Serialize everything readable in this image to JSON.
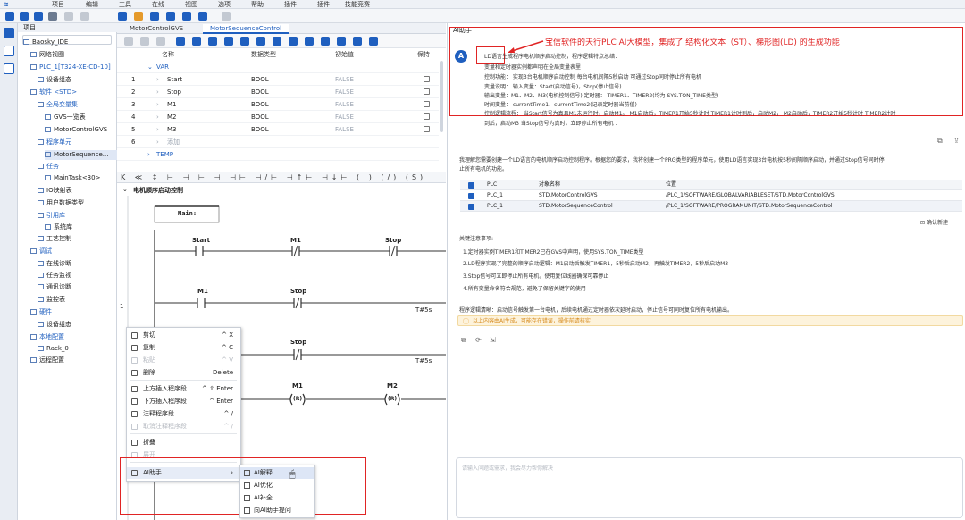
{
  "menubar": {
    "items": [
      "项目",
      "编辑",
      "工具",
      "在线",
      "视图",
      "选项",
      "帮助",
      "插件",
      "插件",
      "技能竞赛"
    ]
  },
  "tree": {
    "header": "项目",
    "items": [
      {
        "label": "Baosky_IDE",
        "indent": 0
      },
      {
        "label": "网络视图",
        "indent": 1
      },
      {
        "label": "PLC_1[T324-XE-CD-10]",
        "indent": 1
      },
      {
        "label": "设备组态",
        "indent": 2
      },
      {
        "label": "软件 <STD>",
        "indent": 1
      },
      {
        "label": "全局变量集",
        "indent": 2
      },
      {
        "label": "GVS一览表",
        "indent": 3
      },
      {
        "label": "MotorControlGVS",
        "indent": 3
      },
      {
        "label": "程序单元",
        "indent": 2
      },
      {
        "label": "MotorSequence...",
        "indent": 3
      },
      {
        "label": "任务",
        "indent": 2
      },
      {
        "label": "MainTask<30>",
        "indent": 3
      },
      {
        "label": "IO映射表",
        "indent": 2
      },
      {
        "label": "用户数据类型",
        "indent": 2
      },
      {
        "label": "引用库",
        "indent": 2
      },
      {
        "label": "系统库",
        "indent": 3
      },
      {
        "label": "工艺控制",
        "indent": 2
      },
      {
        "label": "调试",
        "indent": 1
      },
      {
        "label": "在线诊断",
        "indent": 2
      },
      {
        "label": "任务监视",
        "indent": 2
      },
      {
        "label": "通讯诊断",
        "indent": 2
      },
      {
        "label": "监控表",
        "indent": 2
      },
      {
        "label": "硬件",
        "indent": 1
      },
      {
        "label": "设备组态",
        "indent": 2
      },
      {
        "label": "本地配置",
        "indent": 1
      },
      {
        "label": "Rack_0",
        "indent": 2
      },
      {
        "label": "远程配置",
        "indent": 1
      }
    ]
  },
  "tabs": [
    "MotorControlGVS",
    "MotorSequenceControl"
  ],
  "vartable": {
    "headers": [
      "名称",
      "数据类型",
      "初始值",
      "保持"
    ],
    "sections": [
      "VAR",
      "TEMP"
    ],
    "rows": [
      {
        "num": "1",
        "name": "Start",
        "type": "BOOL",
        "init": "FALSE"
      },
      {
        "num": "2",
        "name": "Stop",
        "type": "BOOL",
        "init": "FALSE"
      },
      {
        "num": "3",
        "name": "M1",
        "type": "BOOL",
        "init": "FALSE"
      },
      {
        "num": "4",
        "name": "M2",
        "type": "BOOL",
        "init": "FALSE"
      },
      {
        "num": "5",
        "name": "M3",
        "type": "BOOL",
        "init": "FALSE"
      },
      {
        "num": "6",
        "name": "添加",
        "type": "",
        "init": ""
      }
    ]
  },
  "ladder": {
    "rung_title": "电机顺序启动控制",
    "label_main": "Main:",
    "rung_number": "1",
    "contacts": {
      "start": "Start",
      "m1a": "M1",
      "stop_a": "Stop",
      "m1b": "M1",
      "stop_b": "Stop",
      "stop_c": "Stop",
      "m1_r": "M1",
      "m2_r": "M2",
      "r_symbol": "(R)",
      "timer_a": "T#5s",
      "timer_b": "T#5s"
    }
  },
  "contextmenu": {
    "items": [
      {
        "label": "剪切",
        "shortcut": "^ X",
        "disabled": false
      },
      {
        "label": "复制",
        "shortcut": "^ C",
        "disabled": false
      },
      {
        "label": "粘贴",
        "shortcut": "^ V",
        "disabled": true
      },
      {
        "label": "删除",
        "shortcut": "Delete",
        "disabled": false
      },
      {
        "label": "上方插入程序段",
        "shortcut": "^ ⇧ Enter",
        "disabled": false
      },
      {
        "label": "下方插入程序段",
        "shortcut": "^ Enter",
        "disabled": false
      },
      {
        "label": "注释程序段",
        "shortcut": "^ /",
        "disabled": false
      },
      {
        "label": "取消注释程序段",
        "shortcut": "^ /",
        "disabled": true
      },
      {
        "label": "折叠",
        "shortcut": "",
        "disabled": false
      },
      {
        "label": "展开",
        "shortcut": "",
        "disabled": true
      },
      {
        "label": "AI助手",
        "shortcut": "›",
        "disabled": false
      }
    ],
    "submenu": [
      "AI解释",
      "AI优化",
      "AI补全",
      "向AI助手提问"
    ]
  },
  "ai": {
    "panel_title": "AI助手",
    "annotation": "宝信软件的天行PLC AI大模型，集成了 结构化文本（ST）、梯形图(LD) 的生成功能",
    "avatar_letter": "A",
    "summary_lines": [
      "LD语言生成程序电机顺序启动控制，程序逻辑特点总结：",
      "变量和定时器实例都声明在全局变量表里",
      "控制功能： 实现3台电机顺序启动控制 每台电机间隔5秒启动 可通过Stop同时停止所有电机",
      "变量说明： 输入变量：Start(启动信号)，Stop(停止信号)",
      "输出变量：M1、M2、M3(电机控制信号) 定时器： TIMER1、TIMER2(均为 SYS.TON_TIME类型)",
      "时间变量： currentTime1、currentTime2(记录定时器当前值)",
      "控制逻辑流程： 当Start信号为真且M1未运行时，启动M1。 M1启动后，TIMER1开始5秒计时 TIMER1计时到后，启动M2， M2启动后，TIMER2开始5秒计时 TIMER2计时",
      "到后，启动M3 当Stop信号为真时，立即停止所有电机 ."
    ],
    "intro": [
      "我理解您需要创建一个LD语言的电机顺序启动控制程序。根据您的要求，我将创建一个PRG类型的程序单元，使用LD语言实现3台电机按5秒间隔顺序启动，并通过Stop信号同时停",
      "止所有电机的功能。"
    ],
    "table": {
      "headers": [
        "PLC",
        "对象名称",
        "位置"
      ],
      "rows": [
        [
          "PLC_1",
          "STD.MotorControlGVS",
          "/PLC_1/SOFTWARE/GLOBALVARIABLESET/STD.MotorControlGVS"
        ],
        [
          "PLC_1",
          "STD.MotorSequenceControl",
          "/PLC_1/SOFTWARE/PROGRAMUNIT/STD.MotorSequenceControl"
        ]
      ]
    },
    "confirm_button": "确认新建",
    "notes_title": "关键注意事项:",
    "notes": [
      "1.定时器实例TIMER1和TIMER2已在GVS中声明，使用SYS.TON_TIME类型",
      "2.LD程序实现了完整的顺序启动逻辑：M1启动后触发TIMER1，5秒后启动M2，再触发TIMER2，5秒后启动M3",
      "3.Stop信号可立即停止所有电机，使用复位线圈确保可靠停止",
      "4.所有变量命名符合规范，避免了保留关键字的使用"
    ],
    "summary_footer": "程序逻辑清晰：启动信号触发第一台电机，后续电机通过定时器依次延时启动，停止信号可同时复位所有电机输出。",
    "warning": "以上内容由AI生成，可能存在错误，操作前请核实",
    "input_placeholder": "请输入问题或需求，我会尽力帮你解决"
  },
  "colors": {
    "accent": "#1f5fbf",
    "highlight_red": "#e02424",
    "warning_bg": "#fdf3dc"
  }
}
